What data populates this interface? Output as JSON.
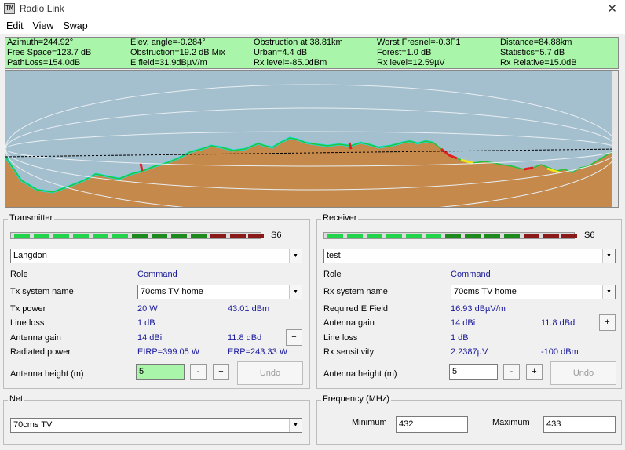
{
  "window": {
    "title": "Radio Link",
    "close": "✕"
  },
  "menu": [
    "Edit",
    "View",
    "Swap"
  ],
  "info": [
    [
      "Azimuth=244.92°",
      "Elev. angle=-0.284°",
      "Obstruction at 38.81km",
      "Worst Fresnel=-0.3F1",
      "Distance=84.88km"
    ],
    [
      "Free Space=123.7 dB",
      "Obstruction=19.2 dB Mix",
      "Urban=4.4 dB",
      "Forest=1.0 dB",
      "Statistics=5.7 dB"
    ],
    [
      "PathLoss=154.0dB",
      "E field=31.9dBµV/m",
      "Rx level=-85.0dBm",
      "Rx level=12.59µV",
      "Rx Relative=15.0dB"
    ]
  ],
  "colors": {
    "info_bg": "#a9f5a9",
    "sky": "#a4bfce",
    "terrain": "#c5894c",
    "earth": "#7a4a2e",
    "link_value": "#1a1a9a"
  },
  "signal_colors": [
    "#22d44a",
    "#22d44a",
    "#22d44a",
    "#22d44a",
    "#22d44a",
    "#22d44a",
    "#1d8a1d",
    "#1d8a1d",
    "#1d8a1d",
    "#1d8a1d",
    "#8a1a1a",
    "#8a1a1a",
    "#8a1a1a"
  ],
  "transmitter": {
    "title": "Transmitter",
    "s_value": "S6",
    "site": "Langdon",
    "role_label": "Role",
    "role_value": "Command",
    "system_label": "Tx system name",
    "system_value": "70cms TV home",
    "power_label": "Tx power",
    "power_w": "20 W",
    "power_dbm": "43.01 dBm",
    "loss_label": "Line loss",
    "loss_value": "1 dB",
    "gain_label": "Antenna gain",
    "gain_dbi": "14 dBi",
    "gain_dbd": "11.8 dBd",
    "gain_btn": "+",
    "rad_label": "Radiated power",
    "eirp": "EIRP=399.05 W",
    "erp": "ERP=243.33 W",
    "height_label": "Antenna height (m)",
    "height_value": "5",
    "minus": "-",
    "plus": "+",
    "undo": "Undo"
  },
  "receiver": {
    "title": "Receiver",
    "s_value": "S6",
    "site": "test",
    "role_label": "Role",
    "role_value": "Command",
    "system_label": "Rx system name",
    "system_value": "70cms TV home",
    "efield_label": "Required E Field",
    "efield_value": "16.93 dBµV/m",
    "gain_label": "Antenna gain",
    "gain_dbi": "14 dBi",
    "gain_dbd": "11.8 dBd",
    "gain_btn": "+",
    "loss_label": "Line loss",
    "loss_value": "1 dB",
    "sens_label": "Rx sensitivity",
    "sens_uv": "2.2387µV",
    "sens_dbm": "-100 dBm",
    "height_label": "Antenna height (m)",
    "height_value": "5",
    "minus": "-",
    "plus": "+",
    "undo": "Undo"
  },
  "net": {
    "title": "Net",
    "value": "70cms TV"
  },
  "frequency": {
    "title": "Frequency (MHz)",
    "min_label": "Minimum",
    "min_value": "432",
    "max_label": "Maximum",
    "max_value": "433"
  }
}
